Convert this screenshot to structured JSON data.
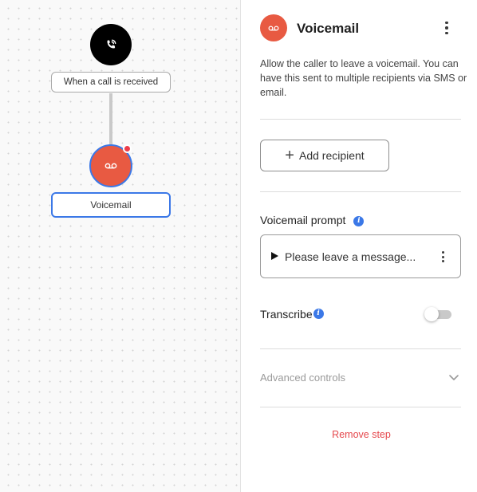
{
  "canvas": {
    "trigger": {
      "icon": "phone-incoming-icon",
      "label": "When a call is received"
    },
    "step": {
      "icon": "voicemail-icon",
      "label": "Voicemail",
      "alert_color": "#ee3d4a"
    }
  },
  "panel": {
    "header": {
      "icon": "voicemail-icon",
      "title": "Voicemail",
      "menu_icon": "kebab-menu-icon"
    },
    "description": "Allow the caller to leave a voicemail. You can have this sent to multiple recipients via SMS or email.",
    "add_recipient": {
      "icon": "plus-icon",
      "label": "Add recipient"
    },
    "voicemail_prompt": {
      "label": "Voicemail prompt",
      "info_icon": "info-icon",
      "value": "Please leave a message...",
      "play_icon": "play-icon",
      "menu_icon": "kebab-menu-icon"
    },
    "transcribe": {
      "label": "Transcribe",
      "info_icon": "info-icon",
      "enabled": false
    },
    "advanced": {
      "label": "Advanced controls",
      "icon": "chevron-down-icon"
    },
    "remove_label": "Remove step"
  },
  "colors": {
    "accent": "#3b78e7",
    "node_red": "#e85a42",
    "danger": "#e5484d"
  }
}
